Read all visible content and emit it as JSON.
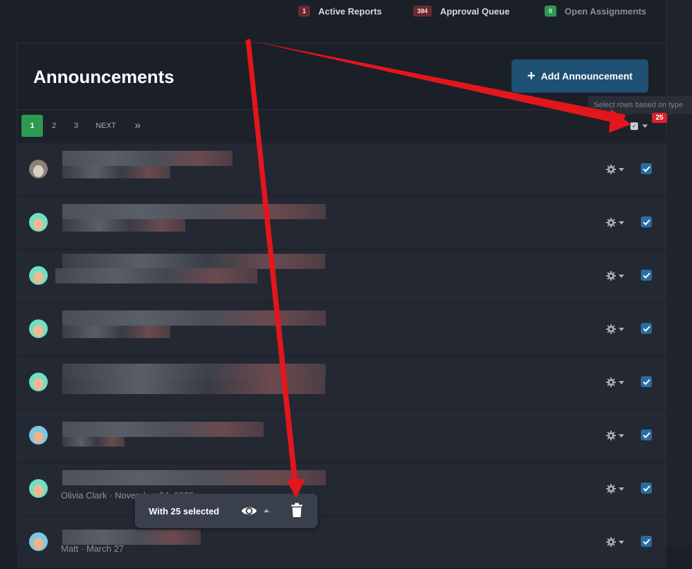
{
  "header": {
    "stats": [
      {
        "count": "1",
        "label": "Active Reports",
        "badge_color": "#6b2a2f"
      },
      {
        "count": "384",
        "label": "Approval Queue",
        "badge_color": "#6b2a2f"
      },
      {
        "count": "0",
        "label": "Open Assignments",
        "badge_color": "#2e9a51"
      }
    ]
  },
  "page": {
    "title": "Announcements",
    "add_button_label": "Add Announcement",
    "add_button_icon": "plus-icon"
  },
  "pager": {
    "pages": [
      "1",
      "2",
      "3"
    ],
    "next_label": "NEXT",
    "last_label": "»",
    "active_page": "1",
    "select_tooltip": "Select rows based on type",
    "selected_count": "25"
  },
  "rows": [
    {
      "avatar": "photo-avatar",
      "subtext": ""
    },
    {
      "avatar": "female-avatar",
      "subtext": ""
    },
    {
      "avatar": "female-avatar",
      "subtext": ""
    },
    {
      "avatar": "female-avatar",
      "subtext": ""
    },
    {
      "avatar": "female-avatar",
      "subtext": ""
    },
    {
      "avatar": "male-avatar",
      "subtext": ""
    },
    {
      "avatar": "female-avatar",
      "subtext": "Olivia Clark · November 24, 2025"
    },
    {
      "avatar": "male-avatar",
      "subtext": "Matt · March 27"
    }
  ],
  "selection_bar": {
    "label": "With 25 selected",
    "view_icon": "eye-icon",
    "delete_icon": "trash-icon"
  },
  "colors": {
    "accent_blue": "#1e5073",
    "active_green": "#2e9a51",
    "annotation_red": "#e3161b"
  }
}
